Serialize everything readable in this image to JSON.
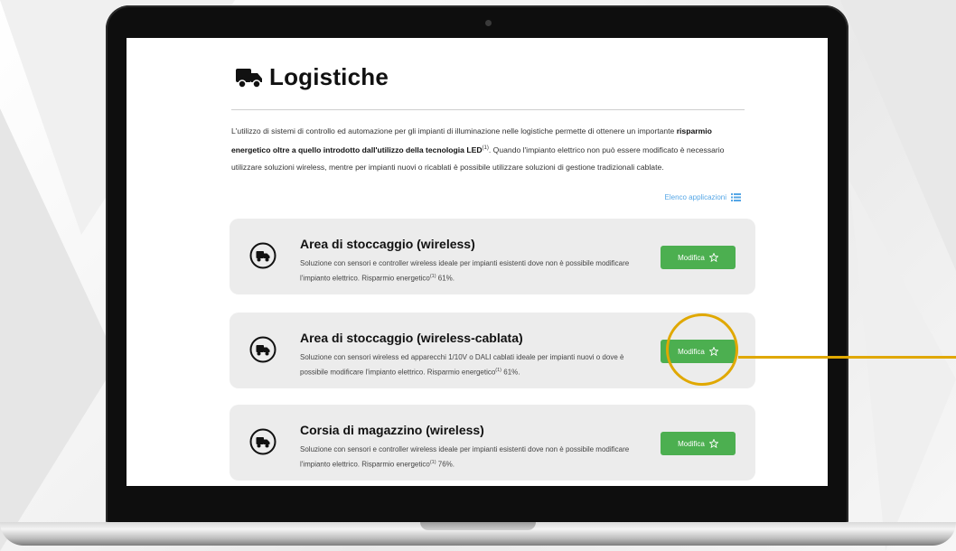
{
  "page": {
    "title": "Logistiche",
    "title_icon": "truck-icon",
    "intro": {
      "part1": "L'utilizzo di sistemi di controllo ed automazione per gli impianti di illuminazione nelle logistiche permette di ottenere un importante ",
      "bold1": "risparmio energetico oltre a quello introdotto dall'utilizzo della tecnologia LED",
      "sup1": "(1)",
      "part2": ". Quando l'impianto elettrico non può essere modificato è necessario utilizzare soluzioni wireless, mentre per impianti nuovi o ricablati è possibile utilizzare soluzioni di gestione tradizionali cablate."
    },
    "apps_link": {
      "label": "Elenco applicazioni",
      "icon": "list-icon"
    }
  },
  "cards": [
    {
      "title": "Area di stoccaggio (wireless)",
      "desc_main": "Soluzione con sensori e controller wireless ideale per impianti esistenti dove non è possibile modificare l'impianto elettrico. Risparmio energetico",
      "desc_sup": "(1)",
      "desc_end": " 61%.",
      "button_label": "Modifica",
      "icon": "truck-circle-icon"
    },
    {
      "title": "Area di stoccaggio (wireless-cablata)",
      "desc_main": "Soluzione con sensori wireless ed apparecchi 1/10V o DALI cablati  ideale per impianti nuovi o dove è possibile modificare l'impianto elettrico. Risparmio energetico",
      "desc_sup": "(1)",
      "desc_end": " 61%.",
      "button_label": "Modifica",
      "icon": "truck-circle-icon"
    },
    {
      "title": "Corsia di magazzino (wireless)",
      "desc_main": "Soluzione con sensori e controller wireless ideale per impianti esistenti dove non è possibile modificare l'impianto elettrico. Risparmio energetico",
      "desc_sup": "(1)",
      "desc_end": " 76%.",
      "button_label": "Modifica",
      "icon": "truck-circle-icon"
    }
  ],
  "colors": {
    "button_green": "#4caf50",
    "link_blue": "#56a7e6",
    "highlight_gold": "#e0a800",
    "card_bg": "#ececec"
  }
}
